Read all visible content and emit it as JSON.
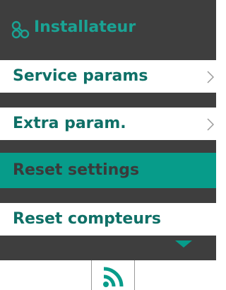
{
  "header": {
    "icon": "settings-nodes-icon",
    "title": "Installateur"
  },
  "menu": {
    "items": [
      {
        "label": "Service params",
        "has_submenu": true
      },
      {
        "label": "Extra param.",
        "has_submenu": true
      },
      {
        "label": "Reset settings",
        "selected": true
      },
      {
        "label": "Reset compteurs"
      }
    ]
  },
  "footer": {
    "icon": "wifi-signal-icon"
  },
  "colors": {
    "accent": "#1aa394",
    "selected_bg": "#079c8a",
    "label_text": "#0f7067",
    "dark_bg": "#3e3e3e"
  }
}
